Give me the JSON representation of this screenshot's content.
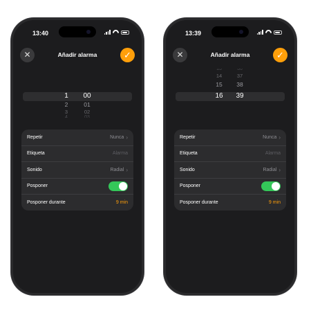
{
  "screens": [
    {
      "status_time": "13:40",
      "title": "Añadir alarma",
      "picker": {
        "hours": [
          "1",
          "2",
          "3",
          "4"
        ],
        "minutes": [
          "00",
          "01",
          "02",
          "03"
        ]
      },
      "settings": [
        {
          "label": "Repetir",
          "value": "Nunca"
        },
        {
          "label": "Etiqueta",
          "placeholder": "Alarma"
        },
        {
          "label": "Sonido",
          "value": "Radial"
        },
        {
          "label": "Posponer",
          "toggle_on": true
        },
        {
          "label": "Posponer durante",
          "value": "9 min"
        }
      ]
    },
    {
      "status_time": "13:39",
      "title": "Añadir alarma",
      "picker": {
        "hours": [
          "13",
          "14",
          "15",
          "16"
        ],
        "minutes": [
          "36",
          "37",
          "38",
          "39"
        ]
      },
      "settings": [
        {
          "label": "Repetir",
          "value": "Nunca"
        },
        {
          "label": "Etiqueta",
          "placeholder": "Alarma"
        },
        {
          "label": "Sonido",
          "value": "Radial"
        },
        {
          "label": "Posponer",
          "toggle_on": true
        },
        {
          "label": "Posponer durante",
          "value": "9 min"
        }
      ]
    }
  ],
  "icons": {
    "close": "close-icon",
    "confirm": "checkmark-icon"
  },
  "colors": {
    "accent": "#ff9f0a",
    "toggle_on": "#34c759",
    "background": "#1c1c1e",
    "card": "#2c2c2e"
  }
}
